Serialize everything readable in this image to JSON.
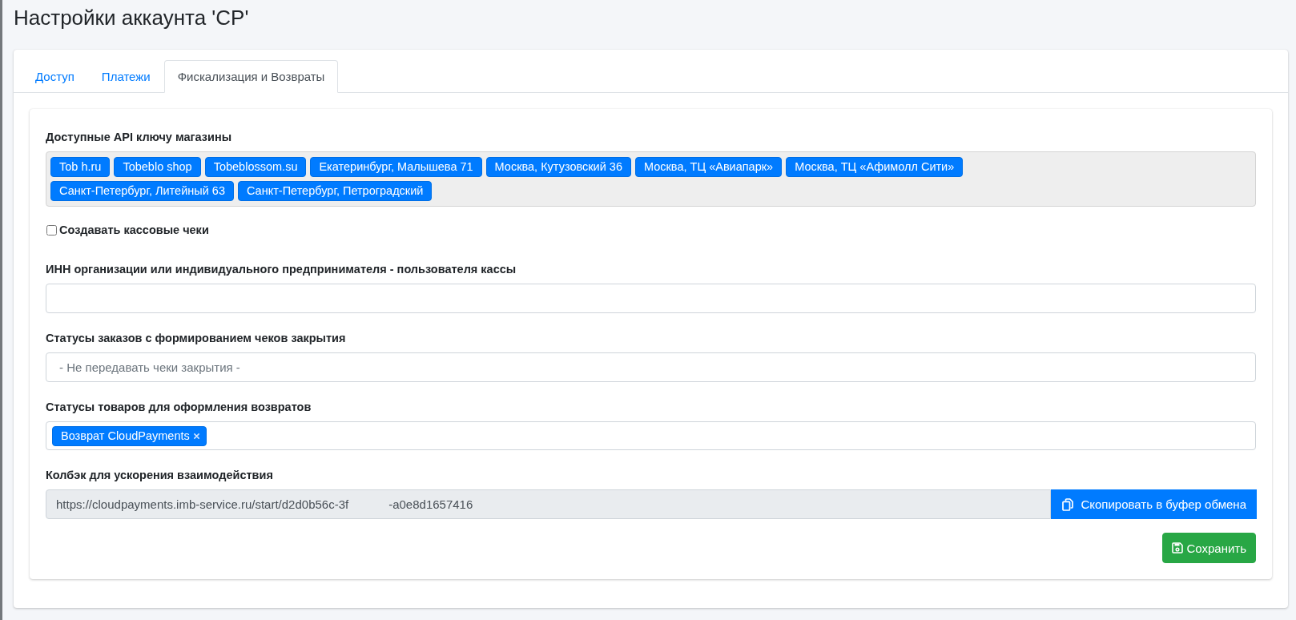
{
  "page": {
    "title": "Настройки аккаунта 'CP'"
  },
  "tabs": [
    {
      "label": "Доступ",
      "selected": false
    },
    {
      "label": "Платежи",
      "selected": false
    },
    {
      "label": "Фискализация и Возвраты",
      "selected": true
    }
  ],
  "form": {
    "shops": {
      "label": "Доступные API ключу магазины",
      "disabled": true,
      "tags": [
        "Tob h.ru",
        "Tobeblo shop",
        "Tobeblossom.su",
        "Екатеринбург, Малышева 71",
        "Москва, Кутузовский 36",
        "Москва, ТЦ «Авиапарк»",
        "Москва, ТЦ «Афимолл Сити»",
        "Санкт-Петербург, Литейный 63",
        "Санкт-Петербург, Петроградский"
      ]
    },
    "create_receipts": {
      "label": "Создавать кассовые чеки",
      "checked": false
    },
    "inn": {
      "label": "ИНН организации или индивидуального предпринимателя - пользователя кассы"
    },
    "order_statuses": {
      "label": "Статусы заказов с формированием чеков закрытия",
      "placeholder": "- Не передавать чеки закрытия -"
    },
    "return_statuses": {
      "label": "Статусы товаров для оформления возвратов",
      "tags": [
        {
          "label": "Возврат CloudPayments",
          "removable": true
        }
      ]
    },
    "callback": {
      "label": "Колбэк для ускорения взаимодействия",
      "value": "https://cloudpayments.imb-service.ru/start/d2d0b56c-3f            -a0e8d1657416",
      "readonly": true,
      "copy_button": "Скопировать в буфер обмена"
    }
  },
  "save_button": {
    "label": "Сохранить"
  }
}
